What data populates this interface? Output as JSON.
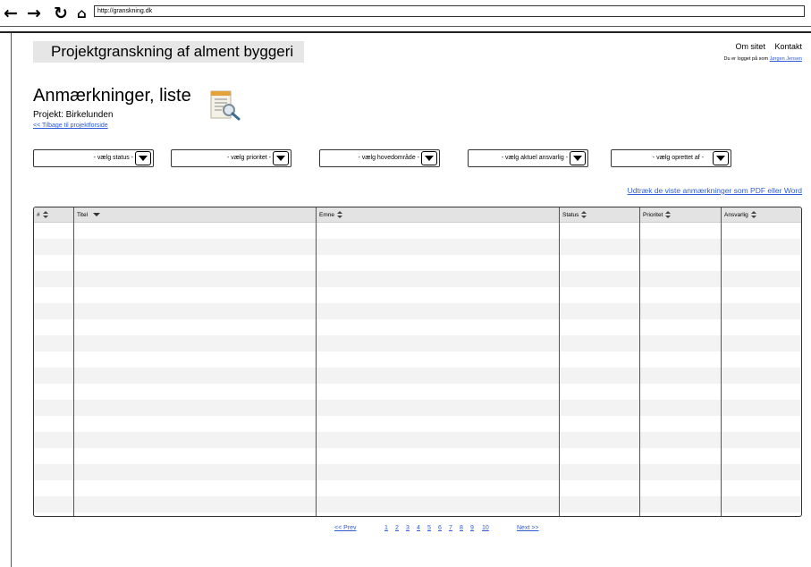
{
  "browser": {
    "back_icon": "arrow-left-icon",
    "forward_icon": "arrow-right-icon",
    "reload_icon": "reload-icon",
    "home_icon": "home-icon",
    "url": "http://granskning.dk"
  },
  "header": {
    "site_title": "Projektgranskning af alment byggeri",
    "links": {
      "about": "Om sitet",
      "contact": "Kontakt"
    },
    "logged_in_text": "Du er logget på som",
    "user_name": "Jørgen Jensen"
  },
  "page": {
    "title": "Anmærkninger, liste",
    "project_label": "Projekt: Birkelunden",
    "back_link": "<< Tilbage til projektforside",
    "icon": "document-search-icon"
  },
  "filters": {
    "status": "- vælg status -",
    "priority": "- vælg prioritet -",
    "main_area": "- vælg hovedområde -",
    "responsible": "- vælg aktuel ansvarlig -",
    "created_by": "- vælg oprettet af -"
  },
  "export_link": "Udtræk de viste anmærkninger som PDF eller Word",
  "table": {
    "columns": {
      "number": "#",
      "title": "Titel",
      "subject": "Emne",
      "status": "Status",
      "priority": "Prioritet",
      "responsible": "Ansvarlig"
    },
    "rows": []
  },
  "pagination": {
    "prev": "<< Prev",
    "pages": [
      "1",
      "2",
      "3",
      "4",
      "5",
      "6",
      "7",
      "8",
      "9",
      "10"
    ],
    "next": "Next >>"
  }
}
